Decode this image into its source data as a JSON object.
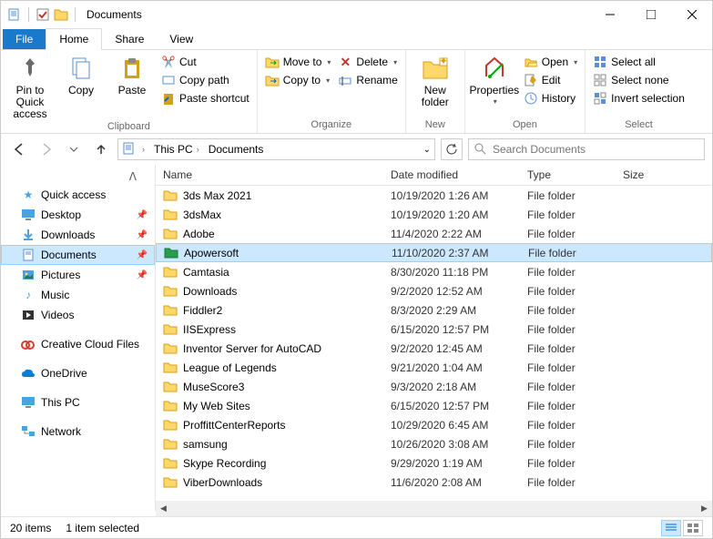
{
  "window": {
    "title": "Documents"
  },
  "tabs": {
    "file": "File",
    "home": "Home",
    "share": "Share",
    "view": "View"
  },
  "ribbon": {
    "clipboard": {
      "label": "Clipboard",
      "pin": "Pin to Quick access",
      "copy": "Copy",
      "paste": "Paste",
      "cut": "Cut",
      "copypath": "Copy path",
      "pasteshortcut": "Paste shortcut"
    },
    "organize": {
      "label": "Organize",
      "moveto": "Move to",
      "copyto": "Copy to",
      "delete": "Delete",
      "rename": "Rename"
    },
    "new": {
      "label": "New",
      "newfolder": "New folder"
    },
    "open": {
      "label": "Open",
      "properties": "Properties",
      "open": "Open",
      "edit": "Edit",
      "history": "History"
    },
    "select": {
      "label": "Select",
      "selectall": "Select all",
      "selectnone": "Select none",
      "invert": "Invert selection"
    }
  },
  "breadcrumb": {
    "pc": "This PC",
    "docs": "Documents"
  },
  "search": {
    "placeholder": "Search Documents"
  },
  "sidebar": {
    "quick": "Quick access",
    "desktop": "Desktop",
    "downloads": "Downloads",
    "documents": "Documents",
    "pictures": "Pictures",
    "music": "Music",
    "videos": "Videos",
    "ccf": "Creative Cloud Files",
    "onedrive": "OneDrive",
    "thispc": "This PC",
    "network": "Network"
  },
  "columns": {
    "name": "Name",
    "date": "Date modified",
    "type": "Type",
    "size": "Size"
  },
  "files": [
    {
      "name": "3ds Max 2021",
      "date": "10/19/2020 1:26 AM",
      "type": "File folder",
      "sel": false,
      "green": false
    },
    {
      "name": "3dsMax",
      "date": "10/19/2020 1:20 AM",
      "type": "File folder",
      "sel": false,
      "green": false
    },
    {
      "name": "Adobe",
      "date": "11/4/2020 2:22 AM",
      "type": "File folder",
      "sel": false,
      "green": false
    },
    {
      "name": "Apowersoft",
      "date": "11/10/2020 2:37 AM",
      "type": "File folder",
      "sel": true,
      "green": true
    },
    {
      "name": "Camtasia",
      "date": "8/30/2020 11:18 PM",
      "type": "File folder",
      "sel": false,
      "green": false
    },
    {
      "name": "Downloads",
      "date": "9/2/2020 12:52 AM",
      "type": "File folder",
      "sel": false,
      "green": false
    },
    {
      "name": "Fiddler2",
      "date": "8/3/2020 2:29 AM",
      "type": "File folder",
      "sel": false,
      "green": false
    },
    {
      "name": "IISExpress",
      "date": "6/15/2020 12:57 PM",
      "type": "File folder",
      "sel": false,
      "green": false
    },
    {
      "name": "Inventor Server for AutoCAD",
      "date": "9/2/2020 12:45 AM",
      "type": "File folder",
      "sel": false,
      "green": false
    },
    {
      "name": "League of Legends",
      "date": "9/21/2020 1:04 AM",
      "type": "File folder",
      "sel": false,
      "green": false
    },
    {
      "name": "MuseScore3",
      "date": "9/3/2020 2:18 AM",
      "type": "File folder",
      "sel": false,
      "green": false
    },
    {
      "name": "My Web Sites",
      "date": "6/15/2020 12:57 PM",
      "type": "File folder",
      "sel": false,
      "green": false
    },
    {
      "name": "ProffittCenterReports",
      "date": "10/29/2020 6:45 AM",
      "type": "File folder",
      "sel": false,
      "green": false
    },
    {
      "name": "samsung",
      "date": "10/26/2020 3:08 AM",
      "type": "File folder",
      "sel": false,
      "green": false
    },
    {
      "name": "Skype Recording",
      "date": "9/29/2020 1:19 AM",
      "type": "File folder",
      "sel": false,
      "green": false
    },
    {
      "name": "ViberDownloads",
      "date": "11/6/2020 2:08 AM",
      "type": "File folder",
      "sel": false,
      "green": false
    }
  ],
  "status": {
    "items": "20 items",
    "selected": "1 item selected"
  }
}
